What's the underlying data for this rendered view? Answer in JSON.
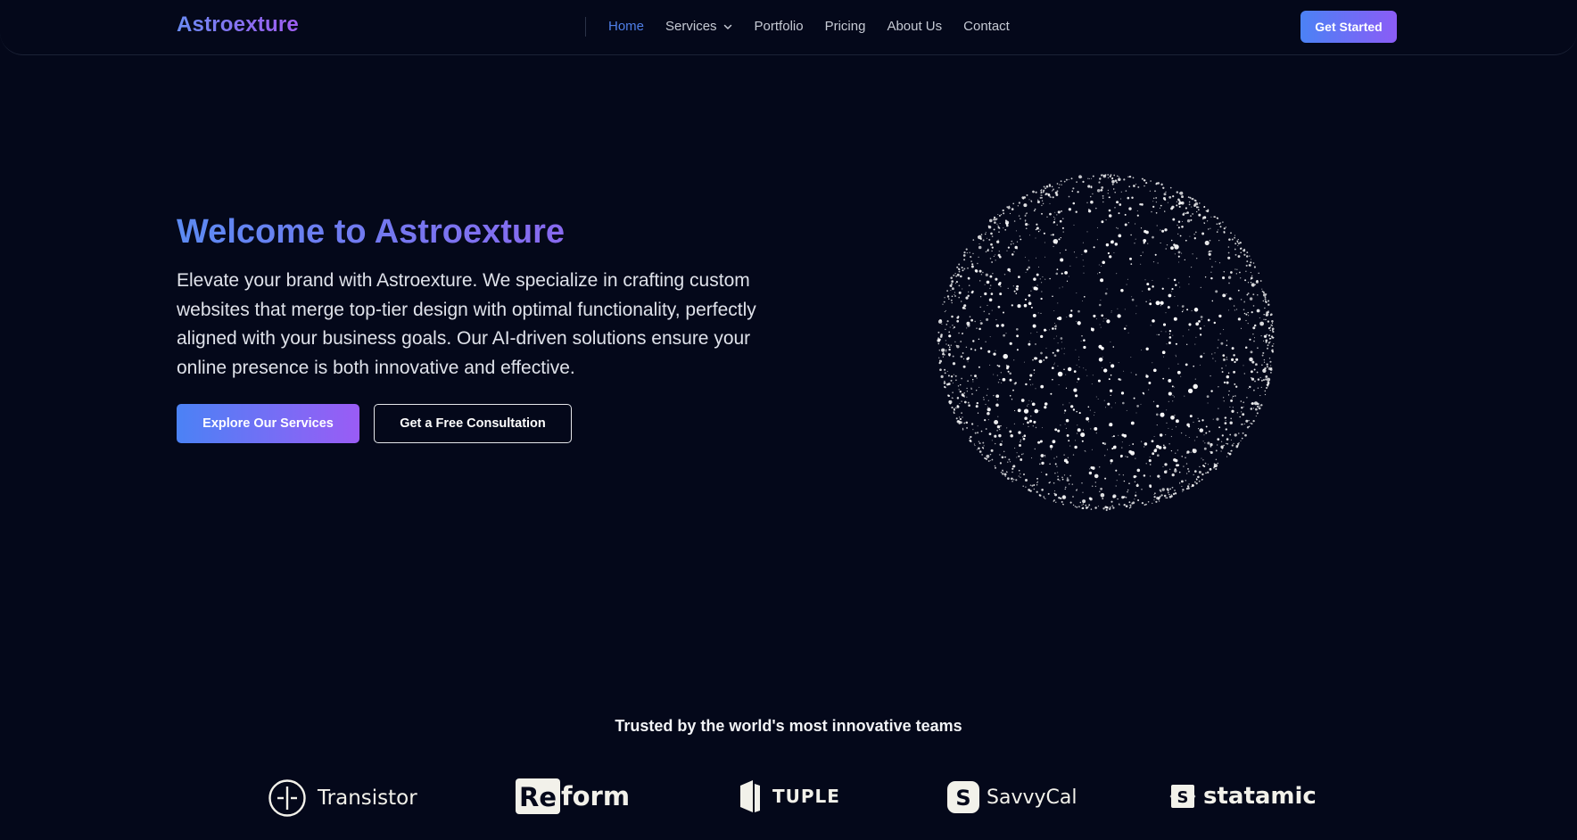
{
  "brand": {
    "name": "Astroexture"
  },
  "nav": {
    "items": [
      {
        "label": "Home",
        "active": true
      },
      {
        "label": "Services",
        "has_dropdown": true
      },
      {
        "label": "Portfolio"
      },
      {
        "label": "Pricing"
      },
      {
        "label": "About Us"
      },
      {
        "label": "Contact"
      }
    ],
    "cta_label": "Get Started"
  },
  "hero": {
    "title": "Welcome to Astroexture",
    "description": "Elevate your brand with Astroexture. We specialize in crafting custom websites that merge top-tier design with optimal functionality, perfectly aligned with your business goals. Our AI-driven solutions ensure your online presence is both innovative and effective.",
    "primary_button": "Explore Our Services",
    "secondary_button": "Get a Free Consultation"
  },
  "trusted": {
    "title": "Trusted by the world's most innovative teams",
    "logos": [
      {
        "name": "Transistor",
        "icon": "transistor-icon"
      },
      {
        "name_box": "Re",
        "name_rest": "form",
        "icon": "reform-logo"
      },
      {
        "name": "TUPLE",
        "icon": "tuple-icon"
      },
      {
        "name": "SavvyCal",
        "icon": "savvycal-icon"
      },
      {
        "name": "statamic",
        "icon": "statamic-icon"
      }
    ]
  },
  "colors": {
    "background": "#04081a",
    "accent_blue": "#4b82f5",
    "accent_purple": "#8b5cf6",
    "nav_active": "#4f7fe8"
  }
}
